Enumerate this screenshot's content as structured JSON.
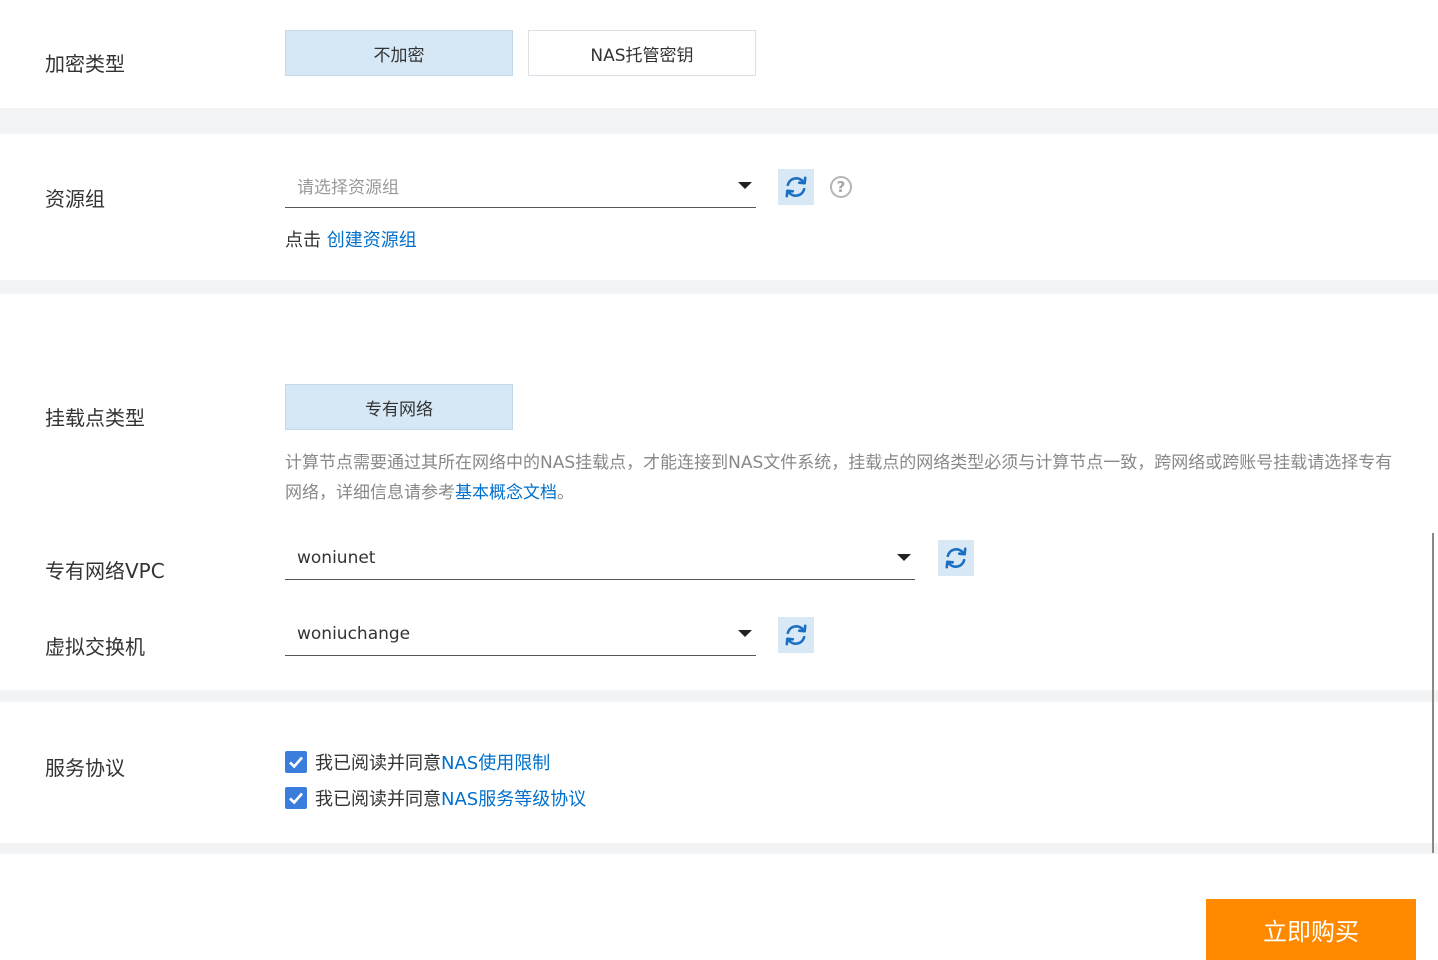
{
  "encryption": {
    "label": "加密类型",
    "options": [
      "不加密",
      "NAS托管密钥"
    ],
    "selected": "不加密"
  },
  "resource_group": {
    "label": "资源组",
    "placeholder": "请选择资源组",
    "hint_prefix": "点击 ",
    "hint_link": "创建资源组"
  },
  "mount_point": {
    "label": "挂载点类型",
    "option": "专有网络",
    "description_text": "计算节点需要通过其所在网络中的NAS挂载点，才能连接到NAS文件系统，挂载点的网络类型必须与计算节点一致，跨网络或跨账号挂载请选择专有网络，详细信息请参考",
    "description_link": "基本概念文档",
    "description_end": "。"
  },
  "vpc": {
    "label": "专有网络VPC",
    "value": "woniunet"
  },
  "vswitch": {
    "label": "虚拟交换机",
    "value": "woniuchange"
  },
  "agreement": {
    "label": "服务协议",
    "items": [
      {
        "prefix": "我已阅读并同意",
        "link": "NAS使用限制",
        "checked": true
      },
      {
        "prefix": "我已阅读并同意",
        "link": "NAS服务等级协议",
        "checked": true
      }
    ]
  },
  "buy_button": "立即购买",
  "colors": {
    "accent": "#0070cc",
    "selected_bg": "#d6e8f6",
    "buy": "#ff8a00",
    "checkbox": "#3b7ddd"
  }
}
